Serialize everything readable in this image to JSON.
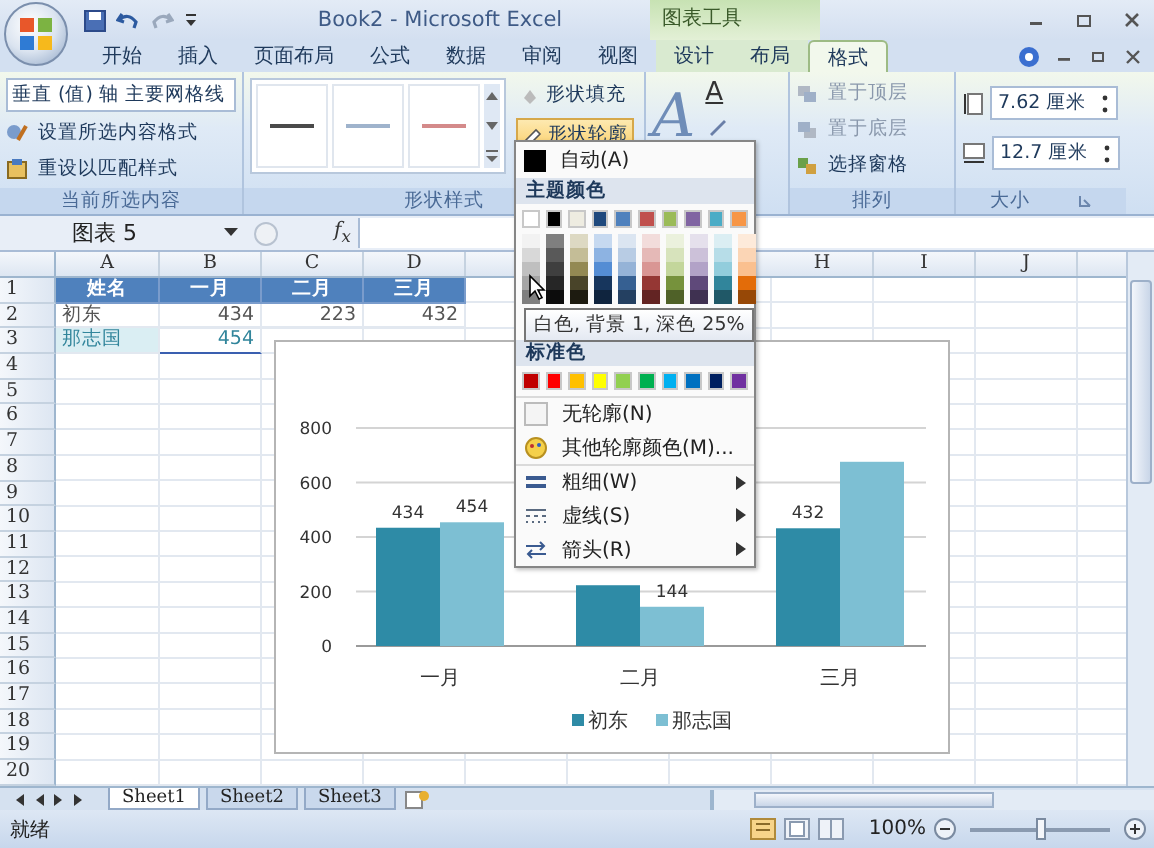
{
  "window": {
    "title": "Book2 - Microsoft Excel",
    "context_group": "图表工具"
  },
  "ribbon_tabs": [
    {
      "label": "开始",
      "selected": false
    },
    {
      "label": "插入",
      "selected": false
    },
    {
      "label": "页面布局",
      "selected": false
    },
    {
      "label": "公式",
      "selected": false
    },
    {
      "label": "数据",
      "selected": false
    },
    {
      "label": "审阅",
      "selected": false
    },
    {
      "label": "视图",
      "selected": false
    },
    {
      "label": "设计",
      "selected": false
    },
    {
      "label": "布局",
      "selected": false
    },
    {
      "label": "格式",
      "selected": true
    }
  ],
  "ribbon": {
    "current_selection": {
      "dropdown": "垂直 (值) 轴 主要网格线",
      "format_button": "设置所选内容格式",
      "reset_button": "重设以匹配样式",
      "group_label": "当前所选内容"
    },
    "shape_styles": {
      "styles": [
        {
          "color": "#4a4a4a"
        },
        {
          "color": "#9fb3cc"
        },
        {
          "color": "#d48a8a"
        }
      ],
      "fill_button": {
        "label": "形状填充",
        "expanded": false
      },
      "outline_button": {
        "label": "形状轮廓",
        "expanded": true
      },
      "group_label": "形状样式"
    },
    "wordart": {
      "big_letter": "A",
      "fill_letter": "A"
    },
    "arrange": {
      "bring_front": "置于顶层",
      "send_back": "置于底层",
      "selection_pane": "选择窗格",
      "group_label": "排列"
    },
    "size": {
      "height": "7.62 厘米",
      "width": "12.7 厘米",
      "group_label": "大小"
    }
  },
  "formula_bar": {
    "name_box": "图表 5",
    "function_label": "f$_{x}$"
  },
  "sheet": {
    "columns": [
      "A",
      "B",
      "C",
      "D",
      "H",
      "I",
      "J"
    ],
    "row_numbers": [
      "1",
      "2",
      "3",
      "4",
      "5",
      "6",
      "7",
      "8",
      "9",
      "10",
      "11",
      "12",
      "13",
      "14",
      "15",
      "16",
      "17",
      "18",
      "19",
      "20"
    ],
    "rows": [
      {
        "kind": "header",
        "highlighted": false,
        "cells": [
          "姓名",
          "一月",
          "二月",
          "三月"
        ]
      },
      {
        "kind": "data",
        "highlighted": false,
        "cells": [
          "初东",
          "434",
          "223",
          "432"
        ]
      },
      {
        "kind": "data",
        "highlighted": true,
        "cells": [
          "那志国",
          "454"
        ]
      }
    ]
  },
  "chart": {
    "chart_data": {
      "type": "bar",
      "categories": [
        "一月",
        "二月",
        "三月"
      ],
      "series": [
        {
          "name": "初东",
          "color": "#2e8ba6",
          "values": [
            434,
            223,
            432
          ]
        },
        {
          "name": "那志国",
          "color": "#7dbfd3",
          "values": [
            454,
            144,
            676
          ]
        }
      ],
      "ylim": [
        0,
        800
      ],
      "yticks": [
        0,
        200,
        400,
        600,
        800
      ],
      "grid": true,
      "legend": "bottom",
      "value_labels": [
        [
          "434",
          null,
          "432"
        ],
        [
          "454",
          "144",
          null
        ]
      ]
    }
  },
  "outline_menu": {
    "auto": "自动(A)",
    "theme_header": "主题颜色",
    "theme_colors": [
      {
        "color": "#ffffff",
        "shades": [
          {
            "color": "#f2f2f2"
          },
          {
            "color": "#d8d8d8"
          },
          {
            "color": "#bfbfbf"
          },
          {
            "color": "#a5a5a5"
          },
          {
            "color": "#7f7f7f"
          }
        ]
      },
      {
        "color": "#000000",
        "shades": [
          {
            "color": "#7f7f7f"
          },
          {
            "color": "#595959"
          },
          {
            "color": "#3f3f3f"
          },
          {
            "color": "#262626"
          },
          {
            "color": "#0c0c0c"
          }
        ]
      },
      {
        "color": "#eeece1",
        "shades": [
          {
            "color": "#ddd9c3"
          },
          {
            "color": "#c4bd97"
          },
          {
            "color": "#938953"
          },
          {
            "color": "#494429"
          },
          {
            "color": "#1d1b10"
          }
        ]
      },
      {
        "color": "#1f497d",
        "shades": [
          {
            "color": "#c6d9f0"
          },
          {
            "color": "#8db3e2"
          },
          {
            "color": "#548dd4"
          },
          {
            "color": "#17365d"
          },
          {
            "color": "#0f243e"
          }
        ]
      },
      {
        "color": "#4f81bd",
        "shades": [
          {
            "color": "#dbe5f1"
          },
          {
            "color": "#b8cce4"
          },
          {
            "color": "#95b3d7"
          },
          {
            "color": "#366092"
          },
          {
            "color": "#244061"
          }
        ]
      },
      {
        "color": "#c0504d",
        "shades": [
          {
            "color": "#f2dcdb"
          },
          {
            "color": "#e5b9b7"
          },
          {
            "color": "#d99694"
          },
          {
            "color": "#953734"
          },
          {
            "color": "#632423"
          }
        ]
      },
      {
        "color": "#9bbb59",
        "shades": [
          {
            "color": "#ebf1dd"
          },
          {
            "color": "#d7e3bc"
          },
          {
            "color": "#c3d69b"
          },
          {
            "color": "#76923c"
          },
          {
            "color": "#4f6128"
          }
        ]
      },
      {
        "color": "#8064a2",
        "shades": [
          {
            "color": "#e5e0ec"
          },
          {
            "color": "#ccc1d9"
          },
          {
            "color": "#b2a2c7"
          },
          {
            "color": "#5f497a"
          },
          {
            "color": "#3f3151"
          }
        ]
      },
      {
        "color": "#4bacc6",
        "shades": [
          {
            "color": "#dbeef3"
          },
          {
            "color": "#b7dde8"
          },
          {
            "color": "#92cddc"
          },
          {
            "color": "#31859b"
          },
          {
            "color": "#205867"
          }
        ]
      },
      {
        "color": "#f79646",
        "shades": [
          {
            "color": "#fdeada"
          },
          {
            "color": "#fbd5b5"
          },
          {
            "color": "#fac08f"
          },
          {
            "color": "#e36c09"
          },
          {
            "color": "#974806"
          }
        ]
      }
    ],
    "tooltip": "白色, 背景 1, 深色 25%",
    "standard_header": "标准色",
    "standard_colors": [
      {
        "color": "#c00000"
      },
      {
        "color": "#ff0000"
      },
      {
        "color": "#ffc000"
      },
      {
        "color": "#ffff00"
      },
      {
        "color": "#92d050"
      },
      {
        "color": "#00b050"
      },
      {
        "color": "#00b0f0"
      },
      {
        "color": "#0070c0"
      },
      {
        "color": "#002060"
      },
      {
        "color": "#7030a0"
      }
    ],
    "items": [
      {
        "label": "无轮廓(N)",
        "kind": "none",
        "submenu": false
      },
      {
        "label": "其他轮廓颜色(M)...",
        "kind": "palette",
        "submenu": false
      },
      {
        "label": "粗细(W)",
        "kind": "weight",
        "submenu": true
      },
      {
        "label": "虚线(S)",
        "kind": "dash",
        "submenu": true
      },
      {
        "label": "箭头(R)",
        "kind": "arrow",
        "submenu": true
      }
    ]
  },
  "sheet_tabs": [
    {
      "label": "Sheet1",
      "selected": true
    },
    {
      "label": "Sheet2",
      "selected": false
    },
    {
      "label": "Sheet3",
      "selected": false
    }
  ],
  "status_bar": {
    "status": "就绪",
    "zoom": "100%",
    "zoom_level": {
      "level": 0.5
    }
  }
}
